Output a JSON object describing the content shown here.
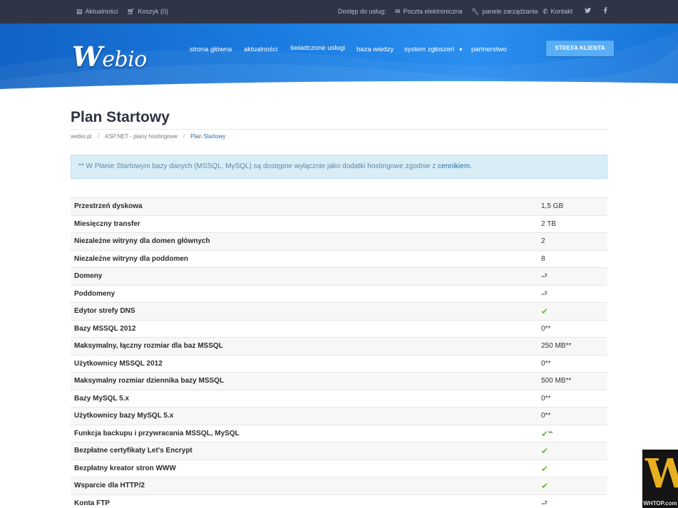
{
  "topbar": {
    "news": "Aktualności",
    "cart": "Koszyk (0)",
    "access": "Dostęp do usług:",
    "mail": "Poczta elektroniczna",
    "panels": "panele zarządzania",
    "contact": "Kontakt"
  },
  "header": {
    "logo_w": "W",
    "logo_rest": "ebio",
    "nav": [
      "strona główna",
      "aktualności",
      "świadczone usługi",
      "baza wiedzy",
      "system zgłoszeń",
      "partnerstwo"
    ],
    "client_button": "STREFA KLIENTA"
  },
  "page": {
    "title": "Plan Startowy",
    "breadcrumb": [
      "webio.pl",
      "ASP.NET - plany hostingowe",
      "Plan Startowy"
    ],
    "note_text": "** W Planie Startowym bazy danych (MSSQL, MySQL) są dostępne wyłącznie jako dodatki hostingowe zgodnie z ",
    "note_link": "cennikiem",
    "note_end": "."
  },
  "table": {
    "rows": [
      {
        "label": "Przestrzeń dyskowa",
        "value": "1,5 GB"
      },
      {
        "label": "Miesięczny transfer",
        "value": "2 TB"
      },
      {
        "label": "Niezależne witryny dla domen głównych",
        "value": "2"
      },
      {
        "label": "Niezależne witryny dla poddomen",
        "value": "8"
      },
      {
        "label": "Domeny",
        "value": "link"
      },
      {
        "label": "Poddomeny",
        "value": "link"
      },
      {
        "label": "Edytor strefy DNS",
        "value": "check"
      },
      {
        "label": "Bazy MSSQL 2012",
        "value": "0**"
      },
      {
        "label": "Maksymalny, łączny rozmiar dla baz MSSQL",
        "value": "250 MB**"
      },
      {
        "label": "Użytkownicy MSSQL 2012",
        "value": "0**"
      },
      {
        "label": "Maksymalny rozmiar dziennika bazy MSSQL",
        "value": "500 MB**"
      },
      {
        "label": "Bazy MySQL 5.x",
        "value": "0**"
      },
      {
        "label": "Użytkownicy bazy MySQL 5.x",
        "value": "0**"
      },
      {
        "label": "Funkcja backupu i przywracania MSSQL, MySQL",
        "value": "check**"
      },
      {
        "label": "Bezpłatne certyfikaty Let's Encrypt",
        "value": "check"
      },
      {
        "label": "Bezpłatny kreator stron WWW",
        "value": "check"
      },
      {
        "label": "Wsparcie dla HTTP/2",
        "value": "check"
      },
      {
        "label": "Konta FTP",
        "value": "link"
      }
    ]
  },
  "badge": {
    "big": "W",
    "small": "WHTOP.com"
  },
  "colors": {
    "topbar": "#2f3547",
    "header": "#1a7ce0",
    "note_bg": "#d9edf7",
    "check": "#66bb33",
    "badge_gold": "#e8b020"
  }
}
